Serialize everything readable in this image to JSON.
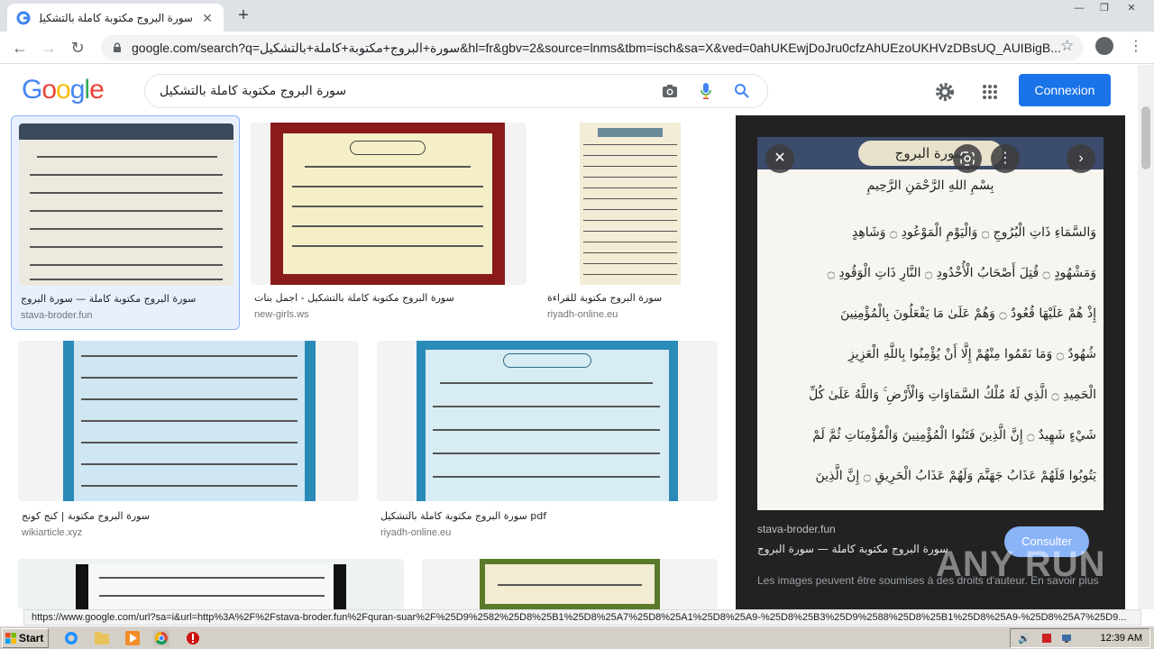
{
  "browser": {
    "tab_title": "سورة البروج مكتوبة كاملة بالتشكيل -",
    "tab_close": "✕",
    "new_tab": "+",
    "url": "google.com/search?q=سورة+البروج+مكتوبة+كاملة+بالتشكيل&hl=fr&gbv=2&source=lnms&tbm=isch&sa=X&ved=0ahUKEwjDoJru0cfzAhUEzoUKHVzDBsUQ_AUIBigB..."
  },
  "google": {
    "logo": [
      "G",
      "o",
      "o",
      "g",
      "l",
      "e"
    ],
    "query": "سورة البروج مكتوبة كاملة بالتشكيل",
    "signin_label": "Connexion"
  },
  "results": [
    {
      "title": "سورة البروج مكتوبة كاملة — سورة البروج",
      "source": "stava-broder.fun"
    },
    {
      "title": "سورة البروج مكتوبة كاملة بالتشكيل - اجمل بنات",
      "source": "new-girls.ws"
    },
    {
      "title": "سورة البروج مكتوبة للقراءة",
      "source": "riyadh-online.eu"
    },
    {
      "title": "سورة البروج مكتوبة | كنج كونج",
      "source": "wikiarticle.xyz"
    },
    {
      "title": "سورة البروج مكتوبة كاملة بالتشكيل pdf",
      "source": "riyadh-online.eu"
    }
  ],
  "preview": {
    "source": "stava-broder.fun",
    "title": "سورة البروج مكتوبة كاملة — سورة البروج",
    "visit_label": "Consulter",
    "note": "Les images peuvent être soumises à des droits d'auteur. En savoir plus",
    "watermark": "ANY RUN",
    "header_text": "سورة البروج",
    "basmala": "بِسْمِ اللهِ الرَّحْمَنِ الرَّحِيمِ",
    "verses": [
      "وَالسَّمَاءِ ذَاتِ الْبُرُوجِ ۝ وَالْيَوْمِ الْمَوْعُودِ ۝ وَشَاهِدٍ",
      "وَمَشْهُودٍ ۝ قُتِلَ أَصْحَابُ الْأُخْدُودِ ۝ النَّارِ ذَاتِ الْوَقُودِ ۝",
      "إِذْ هُمْ عَلَيْهَا قُعُودٌ ۝ وَهُمْ عَلَىٰ مَا يَفْعَلُونَ بِالْمُؤْمِنِينَ",
      "شُهُودٌ ۝ وَمَا نَقَمُوا مِنْهُمْ إِلَّا أَنْ يُؤْمِنُوا بِاللَّهِ الْعَزِيزِ",
      "الْحَمِيدِ ۝ الَّذِي لَهُ مُلْكُ السَّمَاوَاتِ وَالْأَرْضِ ۚ وَاللَّهُ عَلَىٰ كُلِّ",
      "شَيْءٍ شَهِيدٌ ۝ إِنَّ الَّذِينَ فَتَنُوا الْمُؤْمِنِينَ وَالْمُؤْمِنَاتِ ثُمَّ لَمْ",
      "يَتُوبُوا فَلَهُمْ عَذَابُ جَهَنَّمَ وَلَهُمْ عَذَابُ الْحَرِيقِ ۝ إِنَّ الَّذِينَ"
    ]
  },
  "status_url": "https://www.google.com/url?sa=i&url=http%3A%2F%2Fstava-broder.fun%2Fquran-suar%2F%25D9%2582%25D8%25B1%25D8%25A7%25D8%25A1%25D8%25A9-%25D8%25B3%25D9%2588%25D8%25B1%25D8%25A9-%25D8%25A7%25D9...",
  "taskbar": {
    "start_label": "Start",
    "clock": "12:39 AM"
  },
  "colors": {
    "accent": "#1a73e8",
    "preview_bg": "#222222",
    "selected_bg": "#e8f0fe"
  }
}
